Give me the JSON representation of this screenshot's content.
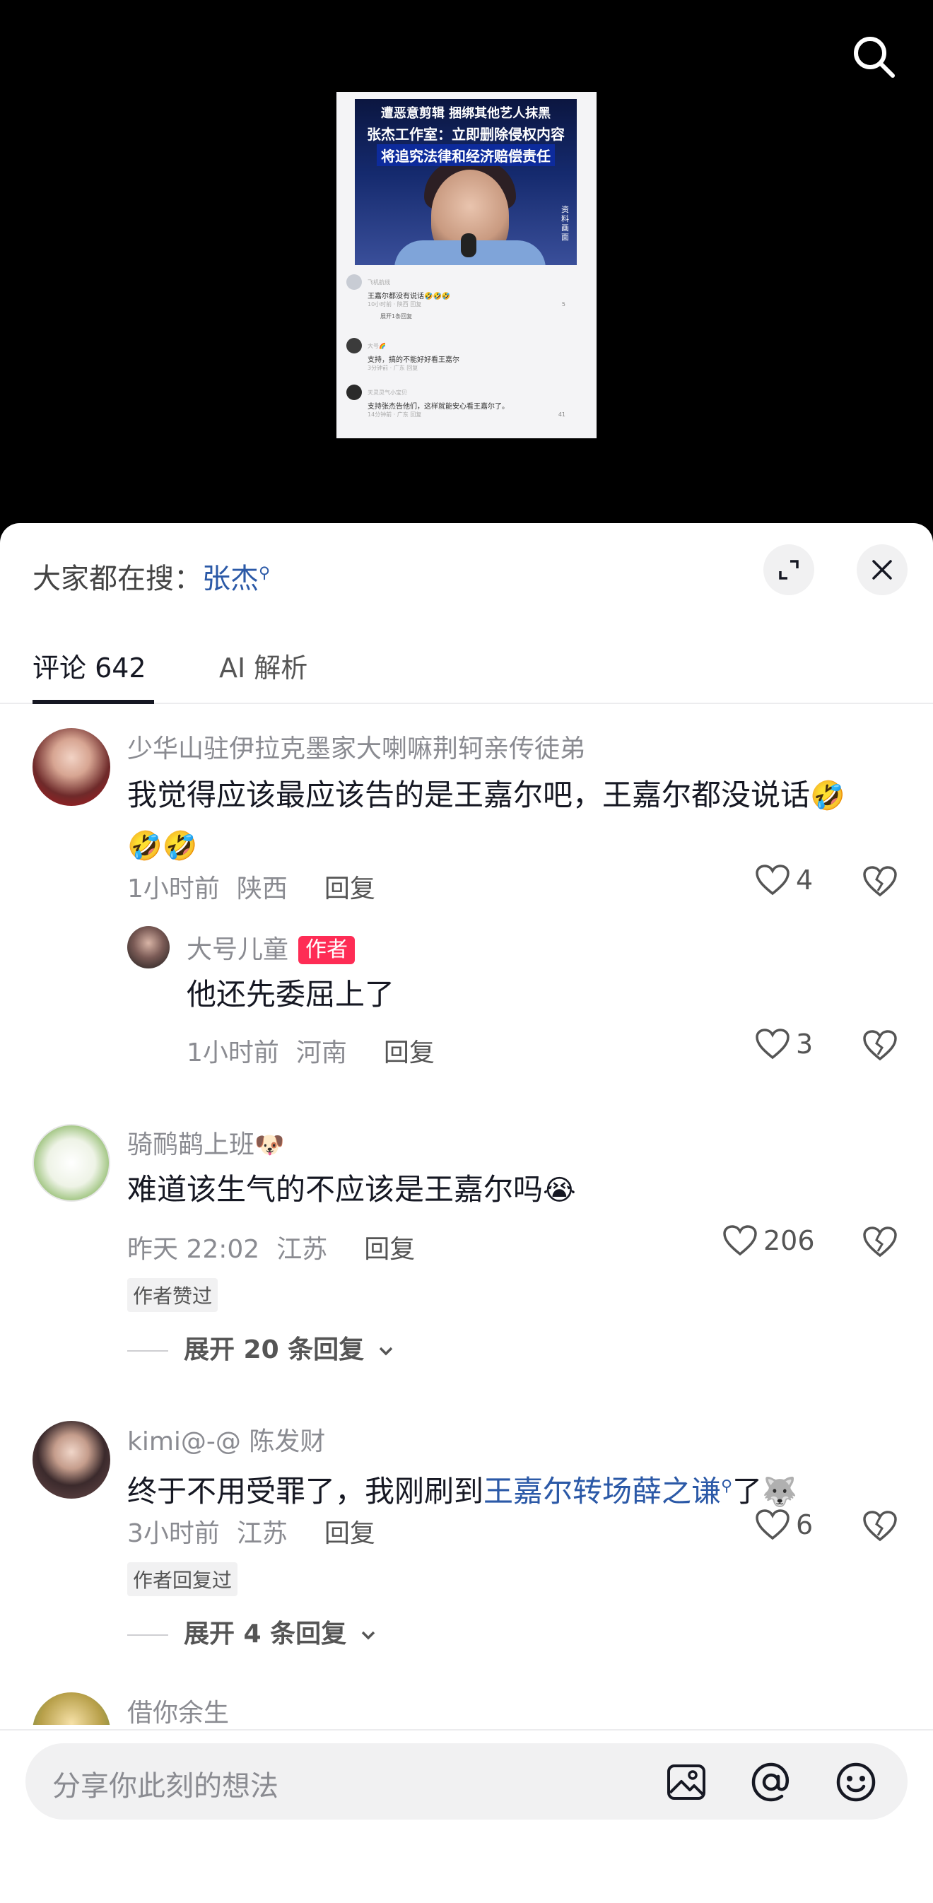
{
  "thumbnail": {
    "headline_lines": [
      "遭恶意剪辑 捆绑其他艺人抹黑",
      "张杰工作室：立即删除侵权内容",
      "将追究法律和经济赔偿责任"
    ],
    "caption": "资料画面",
    "mini_comments": [
      {
        "user": "飞机航线",
        "text": "王嘉尔都没有说话🤣🤣🤣",
        "meta": "10小时前 · 陕西   回复",
        "likes": "5"
      },
      {
        "expand": "展开1条回复"
      },
      {
        "user": "大号🌈",
        "text": "支持，搞的不能好好看王嘉尔",
        "meta": "3分钟前 · 广东   回复",
        "likes": ""
      },
      {
        "user": "天灵灵气小宝贝",
        "text": "支持张杰告他们，这样就能安心看王嘉尔了。",
        "meta": "14分钟前 · 广东   回复",
        "likes": "41"
      }
    ]
  },
  "header": {
    "search_prefix": "大家都在搜：",
    "search_keyword": "张杰"
  },
  "tabs": [
    {
      "label": "评论 642",
      "active": true
    },
    {
      "label": "AI 解析",
      "active": false
    }
  ],
  "comments": [
    {
      "user": "少华山驻伊拉克墨家大喇嘛荆轲亲传徒弟",
      "text_line1": "我觉得应该最应该告的是王嘉尔吧，王嘉尔都没说话",
      "emojis_line1": "🤣",
      "emojis_line2": "🤣🤣",
      "time": "1小时前",
      "location": "陕西",
      "reply_label": "回复",
      "likes": "4",
      "reply": {
        "user": "大号儿童",
        "badge": "作者",
        "text": "他还先委屈上了",
        "time": "1小时前",
        "location": "河南",
        "reply_label": "回复",
        "likes": "3"
      }
    },
    {
      "user": "骑鸸鹋上班",
      "user_emoji": "🐶",
      "text": "难道该生气的不应该是王嘉尔吗",
      "text_emoji": "😭",
      "time": "昨天 22:02",
      "location": "江苏",
      "reply_label": "回复",
      "likes": "206",
      "tag": "作者赞过",
      "expand": "展开 20 条回复"
    },
    {
      "user": "kimi@-@ 陈发财",
      "text_prefix": "终于不用受罪了，我刚刷到",
      "text_link": "王嘉尔转场薛之谦",
      "text_suffix": "了",
      "text_emoji": "🐺",
      "time": "3小时前",
      "location": "江苏",
      "reply_label": "回复",
      "likes": "6",
      "tag": "作者回复过",
      "expand": "展开 4 条回复"
    },
    {
      "user": "借你余生"
    }
  ],
  "input": {
    "placeholder": "分享你此刻的想法"
  },
  "icons": {
    "search": "search-icon",
    "expand": "expand-icon",
    "close": "close-icon",
    "like": "heart-outline-icon",
    "dislike": "broken-heart-icon",
    "image": "image-icon",
    "mention": "at-icon",
    "emoji": "smiley-icon",
    "chevron": "chevron-down-icon"
  },
  "colors": {
    "link": "#2b59a7",
    "author_badge": "#fe2c55",
    "text_primary": "#161823",
    "text_secondary": "#8a8b91"
  }
}
